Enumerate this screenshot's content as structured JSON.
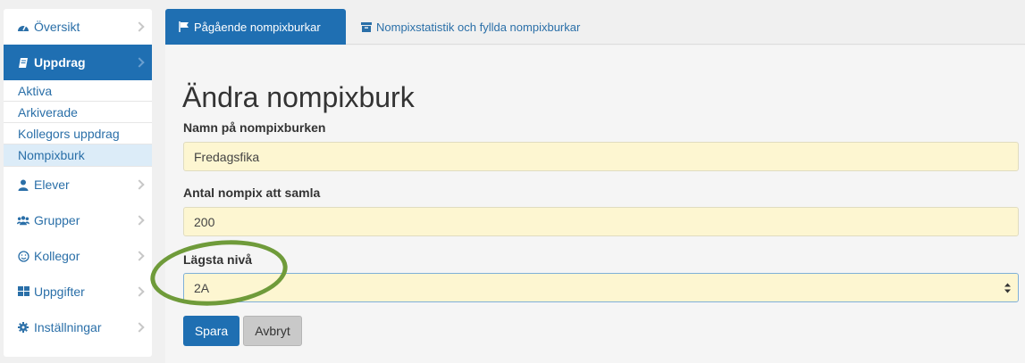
{
  "sidebar": {
    "items": [
      {
        "label": "Översikt",
        "icon": "dashboard-icon"
      },
      {
        "label": "Uppdrag",
        "icon": "book-icon"
      },
      {
        "label": "Elever",
        "icon": "user-icon"
      },
      {
        "label": "Grupper",
        "icon": "users-icon"
      },
      {
        "label": "Kollegor",
        "icon": "smile-icon"
      },
      {
        "label": "Uppgifter",
        "icon": "grid-icon"
      },
      {
        "label": "Inställningar",
        "icon": "gear-icon"
      }
    ],
    "subitems": [
      "Aktiva",
      "Arkiverade",
      "Kollegors uppdrag",
      "Nompixburk"
    ]
  },
  "tabs": {
    "active": "Pågående nompixburkar",
    "inactive": "Nompixstatistik och fyllda nompixburkar"
  },
  "form": {
    "heading": "Ändra nompixburk",
    "name_label": "Namn på nompixburken",
    "name_value": "Fredagsfika",
    "count_label": "Antal nompix att samla",
    "count_value": "200",
    "level_label": "Lägsta nivå",
    "level_value": "2A",
    "save_label": "Spara",
    "cancel_label": "Avbryt"
  },
  "colors": {
    "accent": "#1f6fb2",
    "field_bg": "#fdf6d1",
    "ring": "#6f9b3a"
  }
}
